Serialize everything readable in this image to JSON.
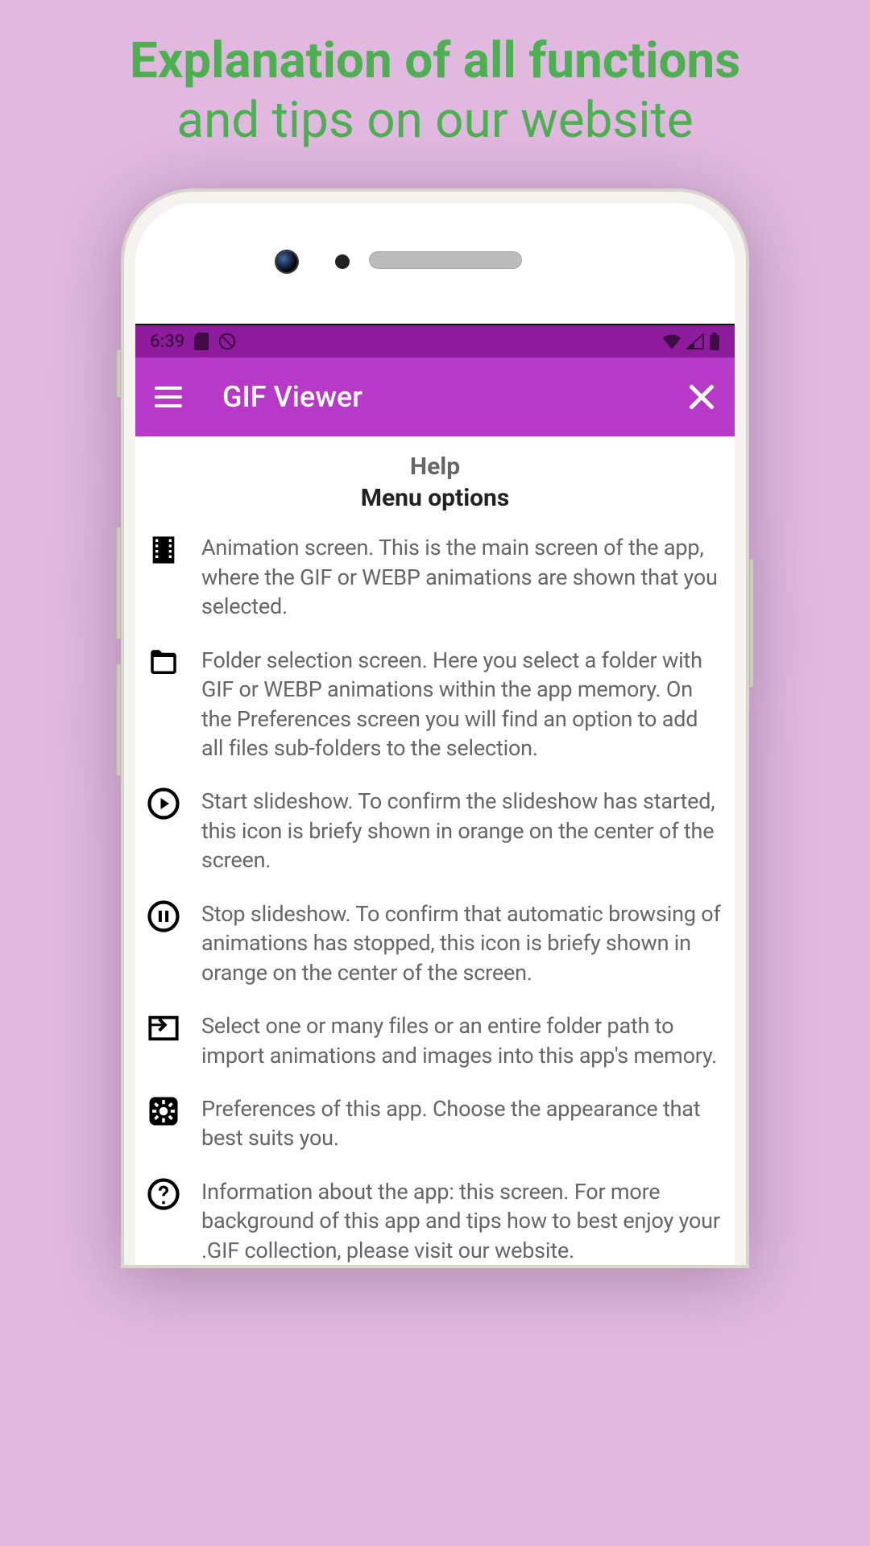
{
  "promo": {
    "line1": "Explanation of all functions",
    "line2": "and tips on our website"
  },
  "statusbar": {
    "time": "6:39"
  },
  "appbar": {
    "title": "GIF Viewer"
  },
  "content": {
    "help_title": "Help",
    "subtitle": "Menu options",
    "items": [
      {
        "icon": "film-icon",
        "text": "Animation screen. This is the main screen of the app, where the GIF or WEBP animations are shown that you selected."
      },
      {
        "icon": "folder-icon",
        "text": "Folder selection screen. Here you select a folder with GIF or WEBP animations within the app memory. On the Preferences screen you will find an option to add all files sub-folders to the selection."
      },
      {
        "icon": "play-circle-icon",
        "text": "Start slideshow. To confirm the slideshow has started, this icon is briefy shown in orange on the center of the screen."
      },
      {
        "icon": "pause-circle-icon",
        "text": "Stop slideshow. To confirm that automatic browsing of animations has stopped, this icon is briefy shown in orange on the center of the screen."
      },
      {
        "icon": "import-icon",
        "text": "Select one or many files or an entire folder path to import animations and images into this app's memory."
      },
      {
        "icon": "settings-box-icon",
        "text": "Preferences of this app. Choose the appearance that best suits you."
      },
      {
        "icon": "help-circle-icon",
        "text": "Information about the app: this screen. For more background of this app and tips how to best enjoy your .GIF collection, please visit our website."
      }
    ]
  }
}
